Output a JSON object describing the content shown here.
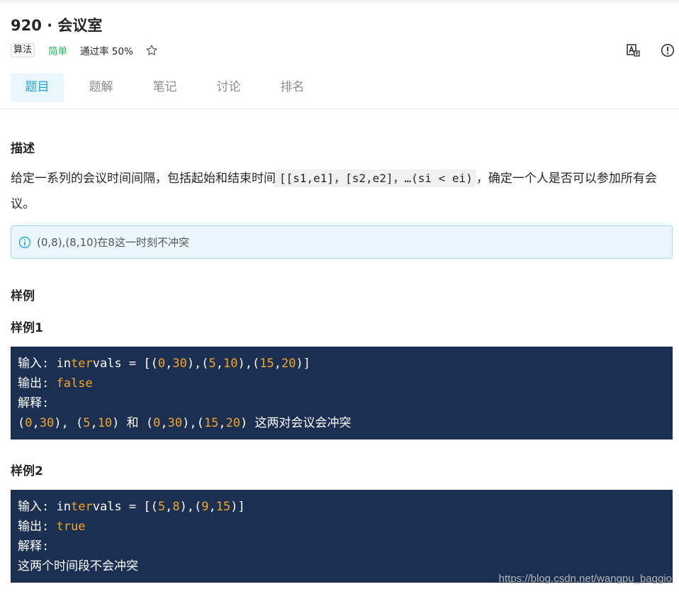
{
  "problem": {
    "id_title": "920 · 会议室",
    "tag": "算法",
    "difficulty": "简单",
    "pass_rate": "通过率 50%"
  },
  "icons": {
    "favorite": "star-icon",
    "translate": "translate-icon",
    "report": "exclamation-circle-icon",
    "info": "info-circle-icon"
  },
  "tabs": [
    {
      "label": "题目",
      "active": true
    },
    {
      "label": "题解",
      "active": false
    },
    {
      "label": "笔记",
      "active": false
    },
    {
      "label": "讨论",
      "active": false
    },
    {
      "label": "排名",
      "active": false
    }
  ],
  "description": {
    "heading": "描述",
    "text_before": "给定一系列的会议时间间隔，包括起始和结束时间",
    "code": "[[s1,e1]，[s2,e2]，…(si < ei)",
    "text_after": "，确定一个人是否可以参加所有会议。"
  },
  "note": "(0,8),(8,10)在8这一时刻不冲突",
  "examples": {
    "heading": "样例",
    "items": [
      {
        "title": "样例1",
        "input_label": "输入:",
        "input_pre": "in",
        "input_kw": "ter",
        "input_post": "vals = [(",
        "input_rest": "0,30),(5,10),(15,20)]",
        "output_label": "输出:",
        "output": "false",
        "explain_label": "解释:",
        "explain": "(0,30), (5,10) 和 (0,30),(15,20) 这两对会议会冲突"
      },
      {
        "title": "样例2",
        "input_label": "输入:",
        "input_pre": "in",
        "input_kw": "ter",
        "input_post": "vals = [(",
        "input_rest": "5,8),(9,15)]",
        "output_label": "输出:",
        "output": "true",
        "explain_label": "解释:",
        "explain": "这两个时间段不会冲突"
      }
    ]
  },
  "watermark": "https://blog.csdn.net/wangpu_baggio",
  "colors": {
    "accent": "#1ea1e6",
    "easy": "#19b955",
    "code_bg": "#1b2f52",
    "code_highlight": "#f5a623"
  }
}
